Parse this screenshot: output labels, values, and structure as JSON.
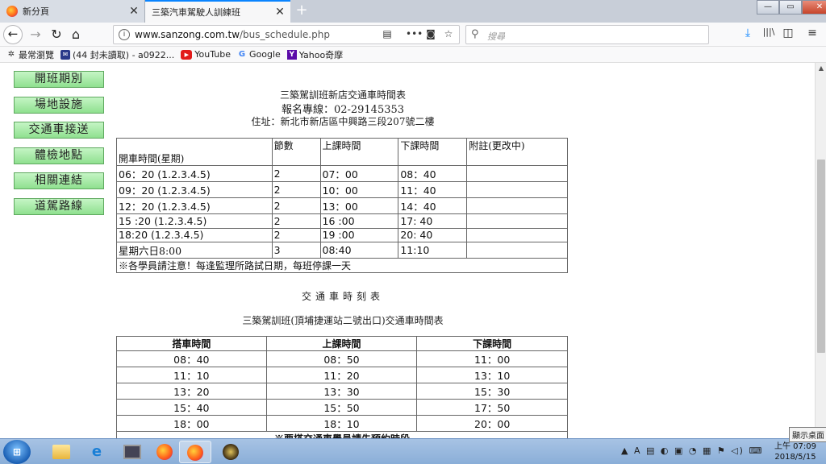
{
  "browser": {
    "tabs": [
      {
        "label": "新分頁",
        "close": "✕"
      },
      {
        "label": "三築汽車駕駛人訓練班",
        "close": "✕"
      }
    ],
    "new_tab": "+",
    "window": {
      "min": "—",
      "max": "▭",
      "close": "✕"
    },
    "nav": {
      "back": "←",
      "forward": "→",
      "reload": "↻",
      "home": "⌂"
    },
    "url": {
      "domain": "www.sanzong.com.tw",
      "path": "/bus_schedule.php"
    },
    "url_icons": {
      "reader": "▤",
      "more": "•••",
      "pocket": "◙",
      "bookmark": "☆"
    },
    "search_placeholder": "搜尋",
    "right_icons": {
      "download": "⤓",
      "library": "|||\\",
      "sidebar": "◫",
      "menu": "≡"
    },
    "bookmarks": [
      {
        "icon": "star-icon",
        "label": "最常瀏覽"
      },
      {
        "icon": "mail-icon",
        "label": "(44 封未讀取) - a0922..."
      },
      {
        "icon": "youtube-icon",
        "label": "YouTube"
      },
      {
        "icon": "google-icon",
        "label": "Google"
      },
      {
        "icon": "yahoo-icon",
        "label": "Yahoo奇摩"
      }
    ]
  },
  "menu": [
    "開班期別",
    "場地設施",
    "交通車接送",
    "體檢地點",
    "相關連結",
    "道駕路線"
  ],
  "header": {
    "title": "三築駕訓班新店交通車時間表",
    "phone": "報名專線：02-29145353",
    "address": "住址：新北市新店區中興路三段207號二樓"
  },
  "table1": {
    "headers": [
      "開車時間(星期)",
      "節數",
      "上課時間",
      "下課時間",
      "附註(更改中)"
    ],
    "rows": [
      [
        "06：20 (1.2.3.4.5)",
        "2",
        "07：00",
        "08：40",
        ""
      ],
      [
        "09：20 (1.2.3.4.5)",
        "2",
        "10：00",
        "11：40",
        ""
      ],
      [
        "12：20 (1.2.3.4.5)",
        "2",
        "13：00",
        "14：40",
        ""
      ],
      [
        "15 :20 (1.2.3.4.5)",
        "2",
        "16 :00",
        "17: 40",
        ""
      ],
      [
        "18:20 (1.2.3.4.5)",
        "2",
        "19 :00",
        "20: 40",
        ""
      ],
      [
        "星期六日8:00",
        "3",
        "08:40",
        "11:10",
        ""
      ]
    ],
    "note": "※各學員請注意！每逢監理所路試日期，每班停課一天"
  },
  "section2": {
    "title": "交通車時刻表",
    "subtitle": "三築駕訓班(頂埔捷運站二號出口)交通車時間表"
  },
  "table2": {
    "headers": [
      "搭車時間",
      "上課時間",
      "下課時間"
    ],
    "rows": [
      [
        "08：40",
        "08：50",
        "11：00"
      ],
      [
        "11：10",
        "11：20",
        "13：10"
      ],
      [
        "13：20",
        "13：30",
        "15：30"
      ],
      [
        "15：40",
        "15：50",
        "17：50"
      ],
      [
        "18：00",
        "18：10",
        "20：00"
      ]
    ],
    "note": "※要搭交通車學員請先預約時段"
  },
  "taskbar": {
    "start": "⊞",
    "tray": "▲ A ▤ ◐ ▣ ◔ ▦ ⚑ ◁) ⌨",
    "time": "上午 07:09",
    "date": "2018/5/15",
    "show_desktop": "顯示桌面"
  }
}
